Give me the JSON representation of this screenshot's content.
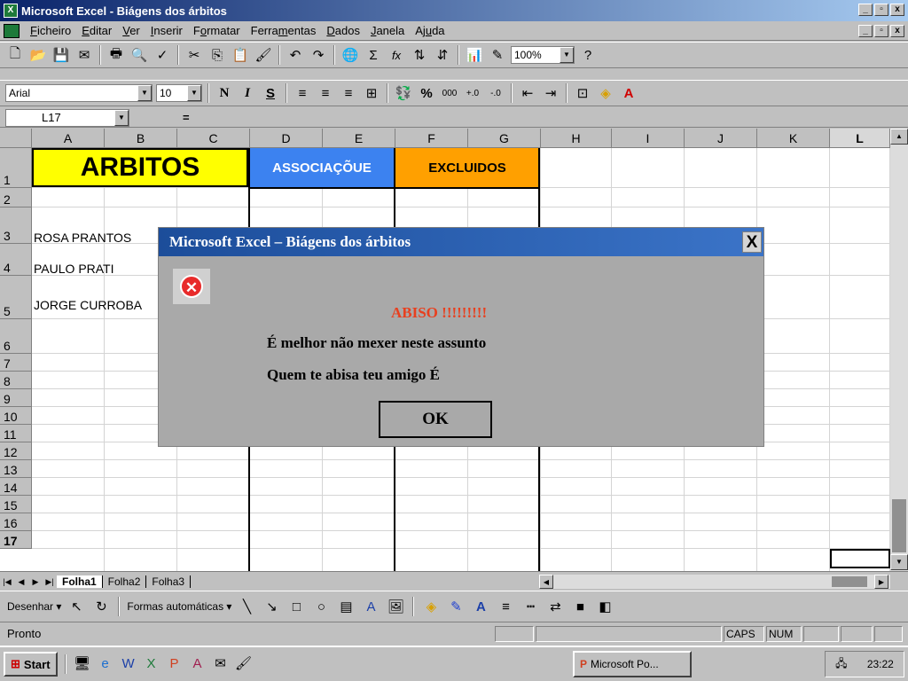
{
  "window": {
    "title": "Microsoft Excel - Biágens dos árbitos",
    "min": "_",
    "max": "▫",
    "close": "x"
  },
  "menubar": {
    "items": [
      {
        "pre": "",
        "u": "F",
        "post": "icheiro"
      },
      {
        "pre": "",
        "u": "E",
        "post": "ditar"
      },
      {
        "pre": "",
        "u": "V",
        "post": "er"
      },
      {
        "pre": "",
        "u": "I",
        "post": "nserir"
      },
      {
        "pre": "F",
        "u": "o",
        "post": "rmatar"
      },
      {
        "pre": "Ferra",
        "u": "m",
        "post": "entas"
      },
      {
        "pre": "",
        "u": "D",
        "post": "ados"
      },
      {
        "pre": "",
        "u": "J",
        "post": "anela"
      },
      {
        "pre": "Aj",
        "u": "u",
        "post": "da"
      }
    ]
  },
  "toolbar": {
    "zoom": "100%"
  },
  "format": {
    "font": "Arial",
    "size": "10",
    "bold": "N",
    "italic": "I",
    "underline": "S",
    "percent": "%",
    "thousands": "000"
  },
  "formula_bar": {
    "cell_ref": "L17",
    "eq": "="
  },
  "columns": [
    "A",
    "B",
    "C",
    "D",
    "E",
    "F",
    "G",
    "H",
    "I",
    "J",
    "K",
    "L"
  ],
  "rows": [
    "1",
    "2",
    "3",
    "4",
    "5",
    "6",
    "7",
    "8",
    "9",
    "10",
    "11",
    "12",
    "13",
    "14",
    "15",
    "16",
    "17"
  ],
  "cells": {
    "arbitos": "ARBITOS",
    "associacoes": "ASSOCIAÇÕUE",
    "excluidos": "EXCLUIDOS",
    "r3": "ROSA PRANTOS",
    "r4": "PAULO PRATI",
    "r5": "JORGE CURROBA"
  },
  "colors": {
    "yellow": "#ffff00",
    "blue": "#3c82f0",
    "orange": "#ffa000",
    "dialog_red": "#e8401f"
  },
  "sheets": {
    "tab1": "Folha1",
    "tab2": "Folha2",
    "tab3": "Folha3"
  },
  "drawing": {
    "draw": "Desenhar ▾",
    "autoshapes": "Formas automáticas ▾"
  },
  "status": {
    "ready": "Pronto",
    "caps": "CAPS",
    "num": "NUM"
  },
  "taskbar": {
    "start": "Start",
    "task": "Microsoft Po...",
    "time": "23:22"
  },
  "dialog": {
    "title": "Microsoft Excel – Biágens dos árbitos",
    "close": "X",
    "heading": "ABISO !!!!!!!!!",
    "line1": "É melhor não mexer neste assunto",
    "line2": "Quem te abisa teu amigo É",
    "ok": "OK",
    "error_glyph": "✕"
  }
}
